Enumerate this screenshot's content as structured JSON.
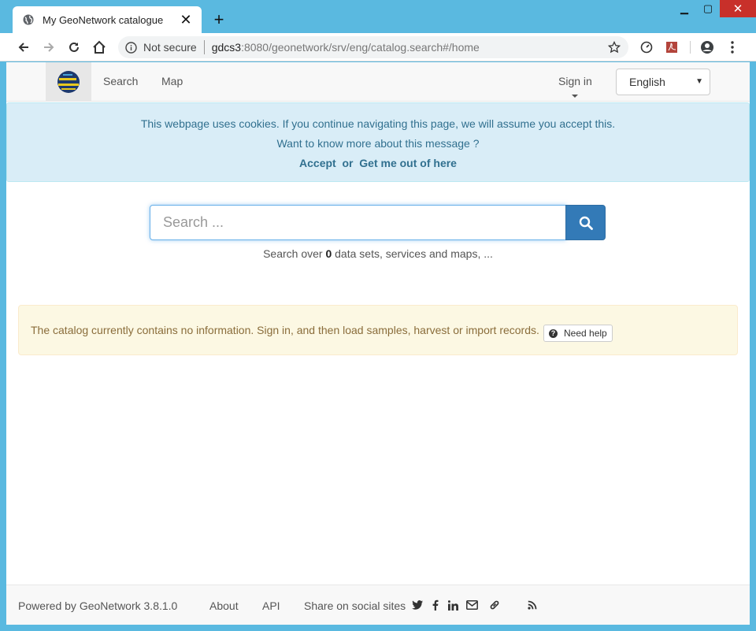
{
  "browser": {
    "tab_title": "My GeoNetwork catalogue",
    "security_label": "Not secure",
    "url_host": "gdcs3",
    "url_rest": ":8080/geonetwork/srv/eng/catalog.search#/home"
  },
  "navbar": {
    "links": [
      "Search",
      "Map"
    ],
    "signin_label": "Sign in",
    "language": "English"
  },
  "cookie": {
    "message": "This webpage uses cookies. If you continue navigating this page, we will assume you accept this.",
    "more_info": "Want to know more about this message ?",
    "accept": "Accept",
    "or": "or",
    "leave": "Get me out of here"
  },
  "search": {
    "placeholder": "Search ...",
    "hint_prefix": "Search over",
    "hint_count": "0",
    "hint_suffix": "data sets, services and maps, ..."
  },
  "notice": {
    "text": "The catalog currently contains no information. Sign in, and then load samples, harvest or import records.",
    "help_label": "Need help"
  },
  "footer": {
    "powered": "Powered by GeoNetwork 3.8.1.0",
    "about": "About",
    "api": "API",
    "share": "Share on social sites"
  },
  "colors": {
    "primary": "#337ab7",
    "info_bg": "#d9edf7",
    "warning_bg": "#fcf8e3",
    "chrome": "#5ab9e0"
  }
}
